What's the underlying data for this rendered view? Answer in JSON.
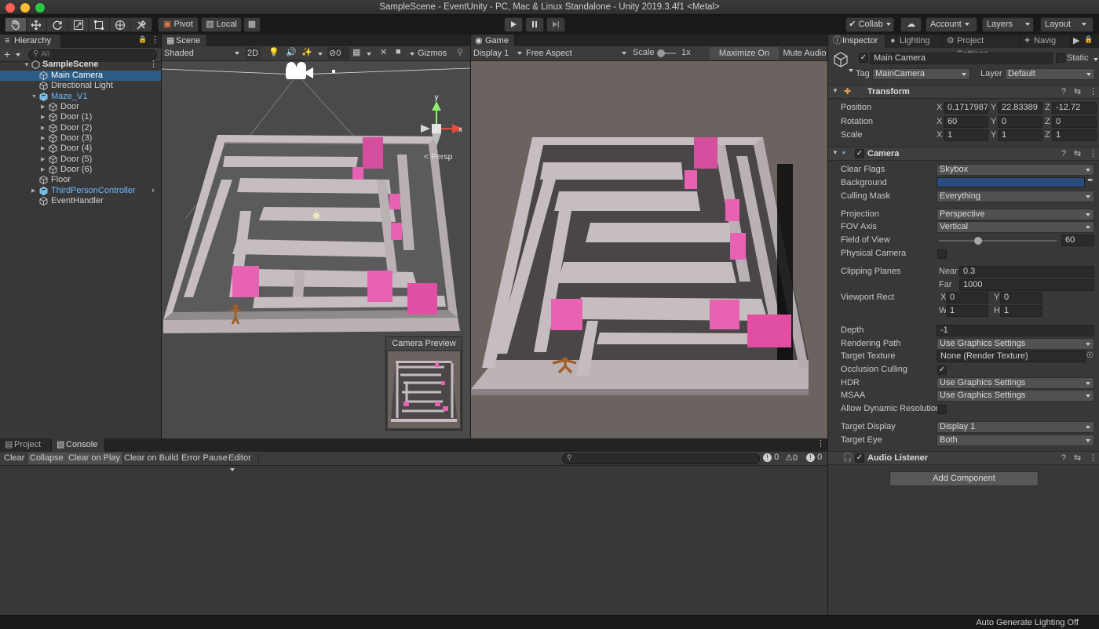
{
  "window": {
    "title": "SampleScene - EventUnity - PC, Mac & Linux Standalone - Unity 2019.3.4f1 <Metal>"
  },
  "toolbar": {
    "pivot": "Pivot",
    "local": "Local",
    "collab": "Collab",
    "account": "Account",
    "layers": "Layers",
    "layout": "Layout"
  },
  "hierarchy": {
    "tab": "Hierarchy",
    "search_placeholder": "All",
    "add": "+",
    "scene": "SampleScene",
    "items": [
      {
        "label": "Main Camera",
        "selected": true,
        "indent": 1
      },
      {
        "label": "Directional Light",
        "indent": 1
      },
      {
        "label": "Maze_V1",
        "prefab": true,
        "expanded": true,
        "indent": 1
      },
      {
        "label": "Door",
        "indent": 2
      },
      {
        "label": "Door (1)",
        "indent": 2
      },
      {
        "label": "Door (2)",
        "indent": 2
      },
      {
        "label": "Door (3)",
        "indent": 2
      },
      {
        "label": "Door (4)",
        "indent": 2
      },
      {
        "label": "Door (5)",
        "indent": 2
      },
      {
        "label": "Door (6)",
        "indent": 2
      },
      {
        "label": "Floor",
        "indent": 1
      },
      {
        "label": "ThirdPersonController",
        "prefab": true,
        "indent": 1
      },
      {
        "label": "EventHandler",
        "indent": 1
      }
    ]
  },
  "scene": {
    "tab": "Scene",
    "shading": "Shaded",
    "mode_2d": "2D",
    "hidden_count": "0",
    "gizmos": "Gizmos",
    "persp": "Persp",
    "gizmo_y": "y",
    "gizmo_x": "x",
    "camera_preview": "Camera Preview"
  },
  "game": {
    "tab": "Game",
    "display": "Display 1",
    "aspect": "Free Aspect",
    "scale_label": "Scale",
    "scale_value": 1,
    "scale_text": "1x",
    "maximize": "Maximize On Play",
    "mute": "Mute Audio"
  },
  "bottom": {
    "tabs": [
      "Project",
      "Console"
    ],
    "buttons": [
      "Clear",
      "Collapse",
      "Clear on Play",
      "Clear on Build",
      "Error Pause",
      "Editor"
    ],
    "counts": [
      "0",
      "0",
      "0"
    ]
  },
  "inspector": {
    "tabs": [
      "Inspector",
      "Lighting",
      "Project Settings",
      "Navig"
    ],
    "object_name": "Main Camera",
    "static_label": "Static",
    "tag_label": "Tag",
    "tag_value": "MainCamera",
    "layer_label": "Layer",
    "layer_value": "Default",
    "transform": {
      "title": "Transform",
      "position_label": "Position",
      "rotation_label": "Rotation",
      "scale_label": "Scale",
      "position": [
        "0.1717987",
        "22.83389",
        "-12.72"
      ],
      "rotation": [
        "60",
        "0",
        "0"
      ],
      "scale": [
        "1",
        "1",
        "1"
      ],
      "axes": [
        "X",
        "Y",
        "Z"
      ]
    },
    "camera": {
      "title": "Camera",
      "rows": [
        {
          "label": "Clear Flags",
          "value": "Skybox"
        },
        {
          "label": "Background",
          "value": ""
        },
        {
          "label": "Culling Mask",
          "value": "Everything"
        },
        {
          "label": "Projection",
          "value": "Perspective"
        },
        {
          "label": "FOV Axis",
          "value": "Vertical"
        },
        {
          "label": "Field of View",
          "value": "60"
        },
        {
          "label": "Physical Camera",
          "value": ""
        },
        {
          "label": "Clipping Planes",
          "value": ""
        },
        {
          "label": "Viewport Rect",
          "value": ""
        },
        {
          "label": "Depth",
          "value": "-1"
        },
        {
          "label": "Rendering Path",
          "value": "Use Graphics Settings"
        },
        {
          "label": "Target Texture",
          "value": "None (Render Texture)"
        },
        {
          "label": "Occlusion Culling",
          "value": ""
        },
        {
          "label": "HDR",
          "value": "Use Graphics Settings"
        },
        {
          "label": "MSAA",
          "value": "Use Graphics Settings"
        },
        {
          "label": "Allow Dynamic Resolution",
          "value": ""
        },
        {
          "label": "Target Display",
          "value": "Display 1"
        },
        {
          "label": "Target Eye",
          "value": "Both"
        }
      ],
      "near_label": "Near",
      "near": "0.3",
      "far_label": "Far",
      "far": "1000",
      "vp_x_label": "X",
      "vp_x": "0",
      "vp_y_label": "Y",
      "vp_y": "0",
      "vp_w_label": "W",
      "vp_w": "1",
      "vp_h_label": "H",
      "vp_h": "1",
      "fov_fraction": 0.33,
      "background_color": "#2b4a7e"
    },
    "audio_listener": "Audio Listener",
    "add_component": "Add Component"
  },
  "status": {
    "text": "Auto Generate Lighting Off"
  },
  "colors": {
    "accent": "#2c5d87",
    "door": "#e55fb0",
    "wall": "#b7aeb1"
  }
}
